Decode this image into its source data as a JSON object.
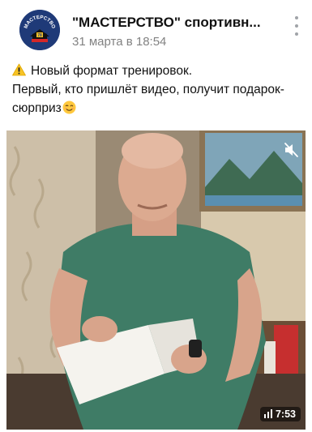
{
  "post": {
    "author": "\"МАСТЕРСТВО\" спортивн...",
    "date": "31 марта в 18:54",
    "avatar_text": "МАСТЕРСТВО",
    "avatar_badge": "78",
    "text_line1": "Новый формат тренировок.",
    "text_line2": "Первый, кто пришлёт видео, получит подарок-сюрприз",
    "icons": [
      "warning-icon",
      "winking-face-icon",
      "more-icon",
      "mute-icon",
      "signal-bars-icon"
    ]
  },
  "video": {
    "duration": "7:53"
  },
  "colors": {
    "author_text": "#111111",
    "date_text": "#828282",
    "avatar_bg": "#1f3a78",
    "warning_yellow": "#f7c325"
  }
}
